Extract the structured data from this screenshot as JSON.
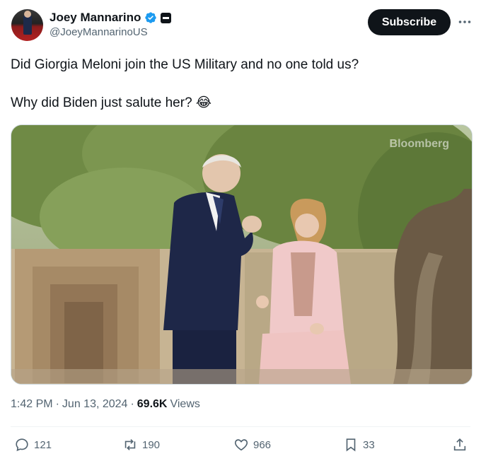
{
  "author": {
    "name": "Joey Mannarino",
    "handle": "@JoeyMannarinoUS",
    "icons": [
      "verified-badge-icon",
      "affiliation-badge-icon"
    ]
  },
  "header": {
    "subscribe_label": "Subscribe",
    "more_icon": "more-dots-icon"
  },
  "tweet": {
    "line1": "Did Giorgia Meloni join the US Military and no one told us?",
    "line2": "Why did Biden just salute her? 😂"
  },
  "media": {
    "watermark": "Bloomberg",
    "image": "video-still"
  },
  "meta": {
    "time": "1:42 PM",
    "sep": "·",
    "date": "Jun 13, 2024",
    "sep2": "·",
    "views_count": "69.6K",
    "views_label": "Views"
  },
  "actions": {
    "replies": "121",
    "reposts": "190",
    "likes": "966",
    "bookmarks": "33"
  },
  "colors": {
    "accent": "#1d9bf0",
    "text": "#0f1419",
    "muted": "#536471"
  }
}
